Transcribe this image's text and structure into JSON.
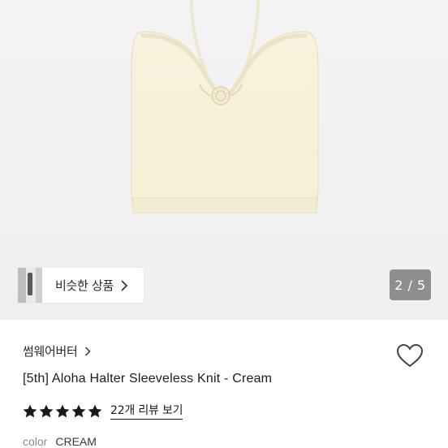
{
  "gallery": {
    "image_alt": "",
    "similar_label": "비슷한 상품",
    "page_counter": "2 / 5"
  },
  "product": {
    "shop_name": "썸웨어버터",
    "title": "[5th] Aloha Halter Sleeveless Knit - Cream",
    "rating": 5,
    "rating_max": 5,
    "review_link": "22개 리뷰 보기",
    "option_label": "color",
    "option_value": "CREAM"
  },
  "colors": {
    "star": "#1a1a1a",
    "knit": "#f7f1dc",
    "counter_bg": "#6e6e6e"
  }
}
